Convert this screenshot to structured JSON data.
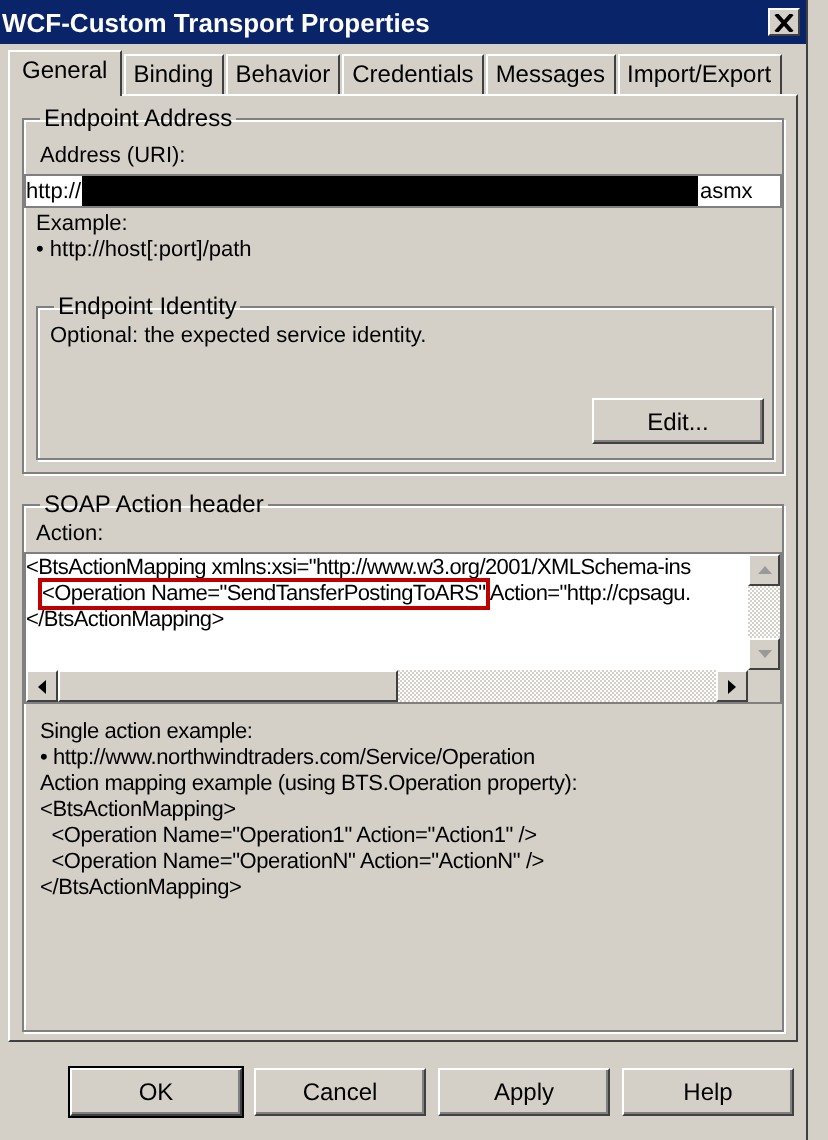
{
  "window": {
    "title": "WCF-Custom Transport Properties"
  },
  "tabs": [
    {
      "label": "General",
      "selected": true
    },
    {
      "label": "Binding",
      "selected": false
    },
    {
      "label": "Behavior",
      "selected": false
    },
    {
      "label": "Credentials",
      "selected": false
    },
    {
      "label": "Messages",
      "selected": false
    },
    {
      "label": "Import/Export",
      "selected": false
    }
  ],
  "endpoint_address": {
    "title": "Endpoint Address",
    "address_label": "Address (URI):",
    "address_start": "http://",
    "address_end": "asmx",
    "example_label": "Example:",
    "example": "• http://host[:port]/path",
    "identity": {
      "title": "Endpoint Identity",
      "hint": "Optional: the expected service identity.",
      "button": "Edit..."
    }
  },
  "soap_action": {
    "title": "SOAP Action header",
    "action_label": "Action:",
    "action_lines": [
      {
        "text": "<BtsActionMapping xmlns:xsi=\"http://www.w3.org/2001/XMLSchema-ins"
      },
      {
        "highlight": "<Operation Name=\"SendTansferPostingToARS\"",
        "text": " Action=\"http://cpsagu."
      },
      {
        "text": "</BtsActionMapping>"
      }
    ],
    "help_lines": [
      "Single action example:",
      "• http://www.northwindtraders.com/Service/Operation",
      "Action mapping example (using BTS.Operation property):",
      "<BtsActionMapping>",
      "  <Operation Name=\"Operation1\" Action=\"Action1\" />",
      "  <Operation Name=\"OperationN\" Action=\"ActionN\" />",
      "</BtsActionMapping>"
    ]
  },
  "buttons": [
    "OK",
    "Cancel",
    "Apply",
    "Help"
  ]
}
